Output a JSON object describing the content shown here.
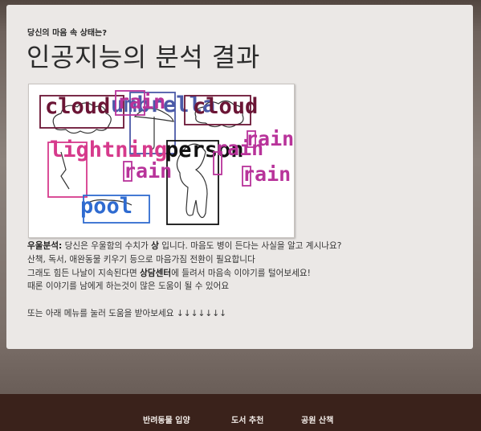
{
  "header": {
    "subtitle": "당신의 마음 속 상태는?",
    "title": "인공지능의 분석 결과"
  },
  "detections": [
    {
      "label": "cloud",
      "color": "#6b1535"
    },
    {
      "label": "umbrella",
      "color": "#4b5aa8"
    },
    {
      "label": "rain",
      "color": "#b8339a"
    },
    {
      "label": "cloud",
      "color": "#6b1535"
    },
    {
      "label": "lightning",
      "color": "#d63a8c"
    },
    {
      "label": "person",
      "color": "#111111"
    },
    {
      "label": "rain",
      "color": "#b8339a"
    },
    {
      "label": "rain",
      "color": "#b8339a"
    },
    {
      "label": "rain",
      "color": "#b8339a"
    },
    {
      "label": "rain",
      "color": "#b8339a"
    },
    {
      "label": "pool",
      "color": "#2f6bd0"
    }
  ],
  "analysis": {
    "line1_label": "우울분석:",
    "line1_pre": " 당신은 우울함의 수치가 ",
    "line1_level": "상",
    "line1_post": " 입니다. 마음도 병이 든다는 사실을 알고 계시나요?",
    "line2": "산책, 독서, 애완동물 키우기 등으로 마음가짐 전환이 필요합니다",
    "line3_pre": "그래도 힘든 나날이 지속된다면 ",
    "line3_bold": "상담센터",
    "line3_post": "에 들려서 마음속 이야기를 털어보세요!",
    "line4": "때론 이야기를 남에게 하는것이 많은 도움이 될 수 있어요",
    "line5": "또는 아래 메뉴를 눌러 도움을 받아보세요 ↓↓↓↓↓↓↓"
  },
  "footer_menu": [
    "반려동물 입양",
    "도서 추천",
    "공원 산책"
  ]
}
